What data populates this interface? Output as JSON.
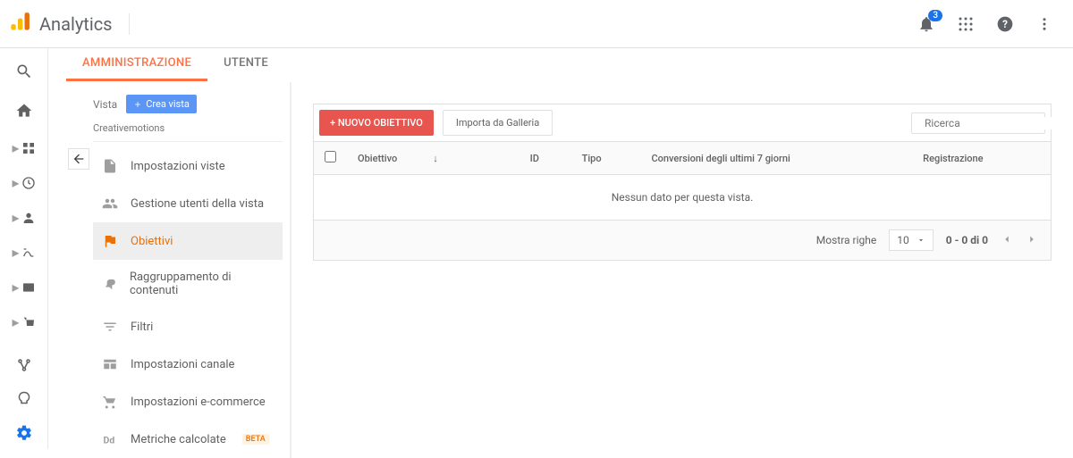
{
  "header": {
    "brand": "Analytics",
    "notif_count": "3"
  },
  "tabs": {
    "admin": "AMMINISTRAZIONE",
    "user": "UTENTE"
  },
  "admin": {
    "vista_label": "Vista",
    "crea_vista": "Crea vista",
    "property_name": "Creativemotions",
    "items": {
      "view_settings": "Impostazioni viste",
      "user_mgmt": "Gestione utenti della vista",
      "goals": "Obiettivi",
      "content_group": "Raggruppamento di contenuti",
      "filters": "Filtri",
      "channel": "Impostazioni canale",
      "ecommerce": "Impostazioni e-commerce",
      "calc_metrics": "Metriche calcolate",
      "beta": "BETA"
    }
  },
  "panel": {
    "new_goal": "+ NUOVO OBIETTIVO",
    "import_gallery": "Importa da Galleria",
    "search_placeholder": "Ricerca",
    "cols": {
      "goal": "Obiettivo",
      "id": "ID",
      "type": "Tipo",
      "conversions": "Conversioni degli ultimi 7 giorni",
      "recording": "Registrazione"
    },
    "empty": "Nessun dato per questa vista.",
    "show_rows": "Mostra righe",
    "rows_value": "10",
    "range": "0 - 0 di 0"
  }
}
